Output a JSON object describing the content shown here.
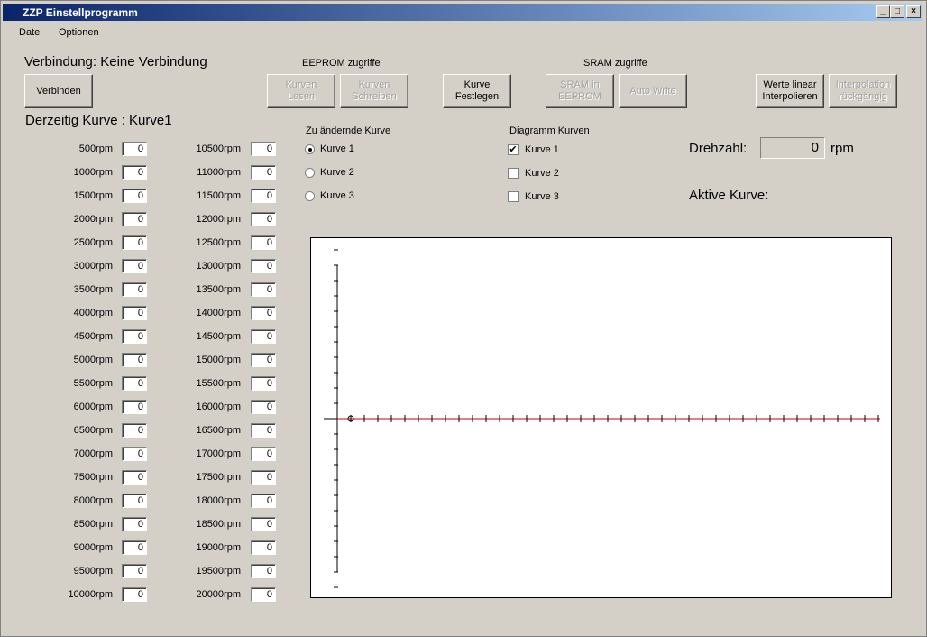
{
  "window": {
    "title": "ZZP Einstellprogramm"
  },
  "menu": {
    "datei": "Datei",
    "optionen": "Optionen"
  },
  "status": {
    "verbindung": "Verbindung: Keine Verbindung",
    "derzeitig": "Derzeitig Kurve : Kurve1"
  },
  "buttons": {
    "verbinden": "Verbinden",
    "eeprom_header": "EEPROM zugriffe",
    "kurven_lesen": "Kurven\nLesen",
    "kurven_schreiben": "Kurven\nSchreiben",
    "kurve_festlegen": "Kurve\nFestlegen",
    "sram_header": "SRAM zugriffe",
    "sram_eeprom": "SRAM  in\nEEPROM",
    "auto_write": "Auto Write",
    "werte_linear": "Werte linear\nInterpolieren",
    "interpolation": "Interpolation\nrückgängig"
  },
  "curve_select": {
    "header": "Zu ändernde Kurve",
    "options": [
      "Kurve 1",
      "Kurve 2",
      "Kurve 3"
    ],
    "selected": 0
  },
  "diagram": {
    "header": "Diagramm Kurven",
    "options": [
      "Kurve 1",
      "Kurve 2",
      "Kurve 3"
    ],
    "checked": [
      true,
      false,
      false
    ]
  },
  "drehzahl": {
    "label": "Drehzahl:",
    "value": "0",
    "unit": "rpm"
  },
  "aktive": {
    "label": "Aktive Kurve:"
  },
  "table_left": [
    {
      "rpm": "500rpm",
      "v": "0"
    },
    {
      "rpm": "1000rpm",
      "v": "0"
    },
    {
      "rpm": "1500rpm",
      "v": "0"
    },
    {
      "rpm": "2000rpm",
      "v": "0"
    },
    {
      "rpm": "2500rpm",
      "v": "0"
    },
    {
      "rpm": "3000rpm",
      "v": "0"
    },
    {
      "rpm": "3500rpm",
      "v": "0"
    },
    {
      "rpm": "4000rpm",
      "v": "0"
    },
    {
      "rpm": "4500rpm",
      "v": "0"
    },
    {
      "rpm": "5000rpm",
      "v": "0"
    },
    {
      "rpm": "5500rpm",
      "v": "0"
    },
    {
      "rpm": "6000rpm",
      "v": "0"
    },
    {
      "rpm": "6500rpm",
      "v": "0"
    },
    {
      "rpm": "7000rpm",
      "v": "0"
    },
    {
      "rpm": "7500rpm",
      "v": "0"
    },
    {
      "rpm": "8000rpm",
      "v": "0"
    },
    {
      "rpm": "8500rpm",
      "v": "0"
    },
    {
      "rpm": "9000rpm",
      "v": "0"
    },
    {
      "rpm": "9500rpm",
      "v": "0"
    },
    {
      "rpm": "10000rpm",
      "v": "0"
    }
  ],
  "table_right": [
    {
      "rpm": "10500rpm",
      "v": "0"
    },
    {
      "rpm": "11000rpm",
      "v": "0"
    },
    {
      "rpm": "11500rpm",
      "v": "0"
    },
    {
      "rpm": "12000rpm",
      "v": "0"
    },
    {
      "rpm": "12500rpm",
      "v": "0"
    },
    {
      "rpm": "13000rpm",
      "v": "0"
    },
    {
      "rpm": "13500rpm",
      "v": "0"
    },
    {
      "rpm": "14000rpm",
      "v": "0"
    },
    {
      "rpm": "14500rpm",
      "v": "0"
    },
    {
      "rpm": "15000rpm",
      "v": "0"
    },
    {
      "rpm": "15500rpm",
      "v": "0"
    },
    {
      "rpm": "16000rpm",
      "v": "0"
    },
    {
      "rpm": "16500rpm",
      "v": "0"
    },
    {
      "rpm": "17000rpm",
      "v": "0"
    },
    {
      "rpm": "17500rpm",
      "v": "0"
    },
    {
      "rpm": "18000rpm",
      "v": "0"
    },
    {
      "rpm": "18500rpm",
      "v": "0"
    },
    {
      "rpm": "19000rpm",
      "v": "0"
    },
    {
      "rpm": "19500rpm",
      "v": "0"
    },
    {
      "rpm": "20000rpm",
      "v": "0"
    }
  ],
  "plot": {
    "line_color": "#cc0000",
    "x_ticks": 40,
    "y_ticks_above": 11,
    "y_ticks_below": 11
  }
}
